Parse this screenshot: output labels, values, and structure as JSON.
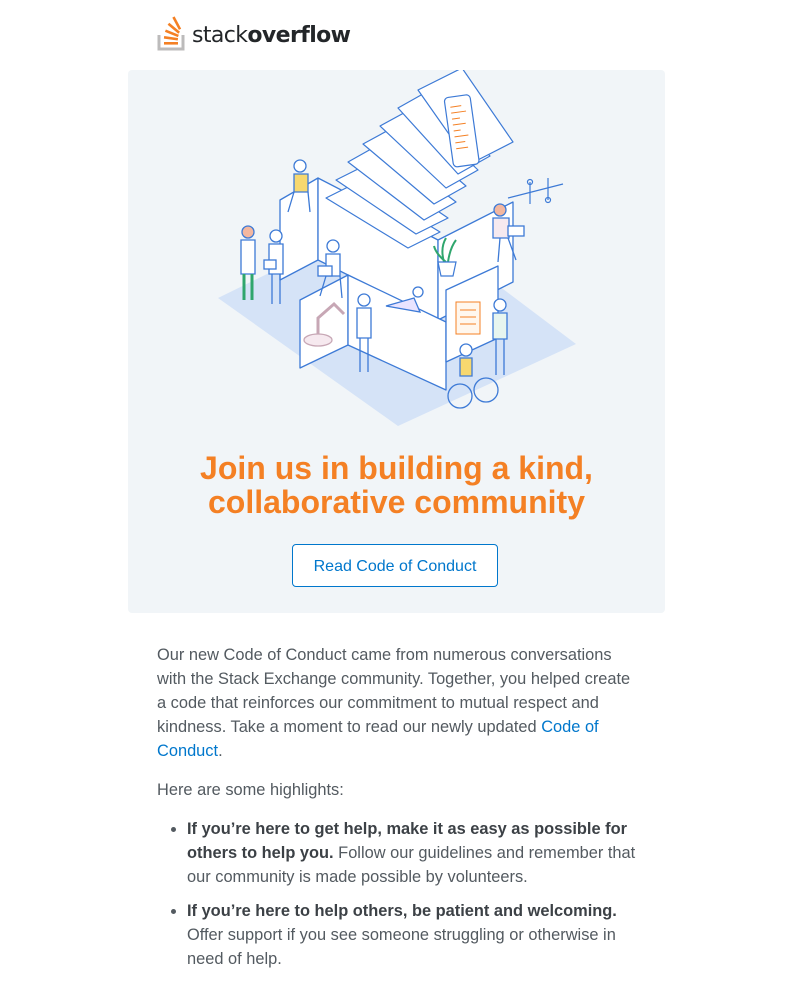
{
  "brand": {
    "name_light": "stack",
    "name_bold": "overflow",
    "logo_colors": [
      "#f48024",
      "#bcbbbb"
    ]
  },
  "hero": {
    "title_line1": "Join us in building a kind,",
    "title_line2": "collaborative community",
    "button_label": "Read Code of Conduct",
    "accent_color": "#f48024",
    "link_color": "#0077cc"
  },
  "body": {
    "intro_text": "Our new Code of Conduct came from numerous conversations with the Stack Exchange community. Together, you helped create a code that reinforces our commitment to mutual respect and kindness. Take a moment to read our newly updated ",
    "intro_link": "Code of Conduct",
    "intro_end": ".",
    "highlights_intro": "Here are some highlights:",
    "highlights": [
      {
        "bold": "If you’re here to get help, make it as easy as possible for others to help you.",
        "text": " Follow our guidelines and remember that our community is made possible by volunteers."
      },
      {
        "bold": "If you’re here to help others, be patient and welcoming.",
        "text": " Offer support if you see someone struggling or otherwise in need of help."
      }
    ]
  }
}
